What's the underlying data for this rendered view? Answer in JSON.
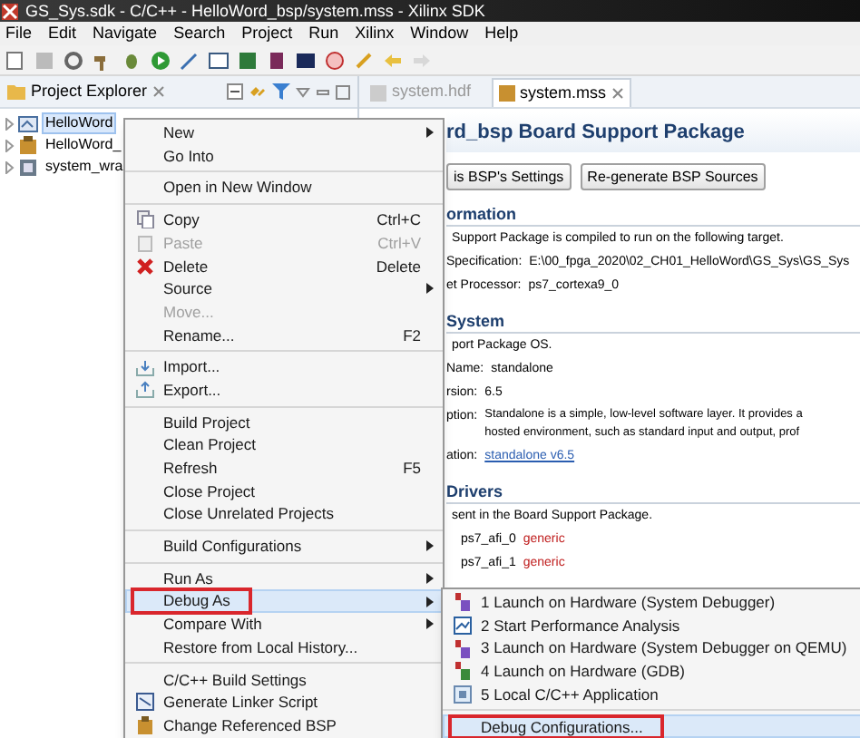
{
  "window": {
    "title": "GS_Sys.sdk - C/C++ - HelloWord_bsp/system.mss - Xilinx SDK"
  },
  "menubar": [
    "File",
    "Edit",
    "Navigate",
    "Search",
    "Project",
    "Run",
    "Xilinx",
    "Window",
    "Help"
  ],
  "project_explorer": {
    "title": "Project Explorer",
    "items": [
      {
        "label": "HelloWord",
        "selected": true
      },
      {
        "label": "HelloWord_",
        "selected": false
      },
      {
        "label": "system_wra",
        "selected": false
      }
    ]
  },
  "editor": {
    "tabs": [
      {
        "label": "system.hdf",
        "selected": false
      },
      {
        "label": "system.mss",
        "selected": true
      }
    ],
    "heading": "rd_bsp Board Support Package",
    "buttons": [
      "is BSP's Settings",
      "Re-generate BSP Sources"
    ],
    "sections": [
      {
        "title": "ormation",
        "lines": [
          {
            "kind": "text",
            "text": "Support Package is compiled to run on the following target."
          },
          {
            "kind": "field",
            "label": "Specification:",
            "value": "E:\\00_fpga_2020\\02_CH01_HelloWord\\GS_Sys\\GS_Sys"
          },
          {
            "kind": "field",
            "label": "et Processor:",
            "value": "ps7_cortexa9_0"
          }
        ]
      },
      {
        "title": "System",
        "lines": [
          {
            "kind": "text",
            "text": "port Package OS."
          },
          {
            "kind": "field",
            "label": "Name:",
            "value": "standalone"
          },
          {
            "kind": "field",
            "label": "rsion:",
            "value": "6.5"
          },
          {
            "kind": "field",
            "label": "ption:",
            "value": "Standalone is a simple, low-level software layer. It provides a\nhosted environment, such as standard input and output, prof"
          },
          {
            "kind": "link",
            "label": "ation:",
            "value": "standalone v6.5"
          }
        ]
      },
      {
        "title": "Drivers",
        "lines": [
          {
            "kind": "text",
            "text": "sent in the Board Support Package."
          },
          {
            "kind": "driver",
            "label": "ps7_afi_0",
            "value": "generic"
          },
          {
            "kind": "driver",
            "label": "ps7_afi_1",
            "value": "generic"
          }
        ]
      }
    ]
  },
  "context_menu": {
    "items": [
      {
        "kind": "item",
        "label": "New",
        "submenu": true
      },
      {
        "kind": "item",
        "label": "Go Into"
      },
      {
        "kind": "separator"
      },
      {
        "kind": "item",
        "label": "Open in New Window"
      },
      {
        "kind": "separator"
      },
      {
        "kind": "item",
        "label": "Copy",
        "shortcut": "Ctrl+C"
      },
      {
        "kind": "item",
        "label": "Paste",
        "shortcut": "Ctrl+V",
        "disabled": true
      },
      {
        "kind": "item",
        "label": "Delete",
        "shortcut": "Delete"
      },
      {
        "kind": "item",
        "label": "Source",
        "submenu": true
      },
      {
        "kind": "item",
        "label": "Move...",
        "disabled": true
      },
      {
        "kind": "item",
        "label": "Rename...",
        "shortcut": "F2"
      },
      {
        "kind": "separator"
      },
      {
        "kind": "item",
        "label": "Import..."
      },
      {
        "kind": "item",
        "label": "Export..."
      },
      {
        "kind": "separator"
      },
      {
        "kind": "item",
        "label": "Build Project"
      },
      {
        "kind": "item",
        "label": "Clean Project"
      },
      {
        "kind": "item",
        "label": "Refresh",
        "shortcut": "F5"
      },
      {
        "kind": "item",
        "label": "Close Project"
      },
      {
        "kind": "item",
        "label": "Close Unrelated Projects"
      },
      {
        "kind": "separator"
      },
      {
        "kind": "item",
        "label": "Build Configurations",
        "submenu": true
      },
      {
        "kind": "separator"
      },
      {
        "kind": "item",
        "label": "Run As",
        "submenu": true
      },
      {
        "kind": "item",
        "label": "Debug As",
        "submenu": true,
        "selected": true,
        "outlined": true
      },
      {
        "kind": "item",
        "label": "Compare With",
        "submenu": true
      },
      {
        "kind": "item",
        "label": "Restore from Local History..."
      },
      {
        "kind": "separator"
      },
      {
        "kind": "item",
        "label": "C/C++ Build Settings"
      },
      {
        "kind": "item",
        "label": "Generate Linker Script"
      },
      {
        "kind": "item",
        "label": "Change Referenced BSP"
      }
    ]
  },
  "debug_submenu": {
    "items": [
      {
        "kind": "item",
        "label": "1 Launch on Hardware (System Debugger)"
      },
      {
        "kind": "item",
        "label": "2 Start Performance Analysis"
      },
      {
        "kind": "item",
        "label": "3 Launch on Hardware (System Debugger on QEMU)"
      },
      {
        "kind": "item",
        "label": "4 Launch on Hardware (GDB)"
      },
      {
        "kind": "item",
        "label": "5 Local C/C++ Application"
      },
      {
        "kind": "separator"
      },
      {
        "kind": "item",
        "label": "Debug Configurations...",
        "selected": true,
        "outlined": true
      }
    ]
  }
}
